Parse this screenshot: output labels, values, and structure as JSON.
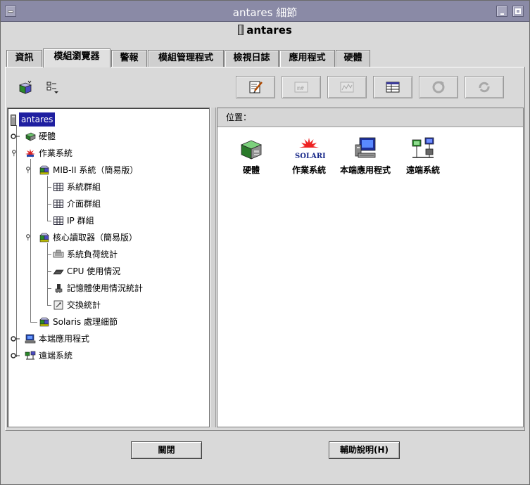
{
  "window": {
    "title": "antares 細節"
  },
  "host": {
    "name": "antares"
  },
  "tabs": [
    {
      "label": "資訊"
    },
    {
      "label": "模組瀏覽器"
    },
    {
      "label": "警報"
    },
    {
      "label": "模組管理程式"
    },
    {
      "label": "檢視日誌"
    },
    {
      "label": "應用程式"
    },
    {
      "label": "硬體"
    }
  ],
  "active_tab": "模組瀏覽器",
  "toolbar": {
    "left": [
      {
        "icon": "view-cube-icon"
      },
      {
        "icon": "view-menu-icon"
      }
    ],
    "right": [
      {
        "icon": "edit-icon",
        "enabled": true
      },
      {
        "icon": "probe-icon",
        "enabled": false
      },
      {
        "icon": "graph-icon",
        "enabled": false
      },
      {
        "icon": "table-icon",
        "enabled": true
      },
      {
        "icon": "refresh-icon",
        "enabled": false
      },
      {
        "icon": "reload-icon",
        "enabled": false
      }
    ]
  },
  "tree": {
    "root": "antares",
    "nodes": [
      {
        "label": "硬體",
        "icon": "hardware-icon"
      },
      {
        "label": "作業系統",
        "icon": "os-icon"
      },
      {
        "label": "MIB-II 系統（簡易版）",
        "icon": "module-icon"
      },
      {
        "label": "系統群組",
        "icon": "table-icon"
      },
      {
        "label": "介面群組",
        "icon": "table-icon"
      },
      {
        "label": "IP 群組",
        "icon": "table-icon"
      },
      {
        "label": "核心讀取器（簡易版）",
        "icon": "module-icon"
      },
      {
        "label": "系統負荷統計",
        "icon": "load-icon"
      },
      {
        "label": "CPU 使用情況",
        "icon": "cpu-icon"
      },
      {
        "label": "記憶體使用情況統計",
        "icon": "memory-icon"
      },
      {
        "label": "交換統計",
        "icon": "swap-icon"
      },
      {
        "label": "Solaris 處理細節",
        "icon": "module-icon"
      },
      {
        "label": "本端應用程式",
        "icon": "local-apps-icon"
      },
      {
        "label": "遠端系統",
        "icon": "remote-systems-icon"
      }
    ]
  },
  "location": {
    "label": "位置："
  },
  "right_icons": [
    {
      "label": "硬體",
      "icon": "hardware-icon"
    },
    {
      "label": "作業系統",
      "icon": "solaris-icon",
      "logo_text": "SOLARIS"
    },
    {
      "label": "本端應用程式",
      "icon": "local-apps-icon"
    },
    {
      "label": "遠端系統",
      "icon": "remote-systems-icon"
    }
  ],
  "buttons": {
    "close": "關閉",
    "help": "輔助說明(H)"
  }
}
